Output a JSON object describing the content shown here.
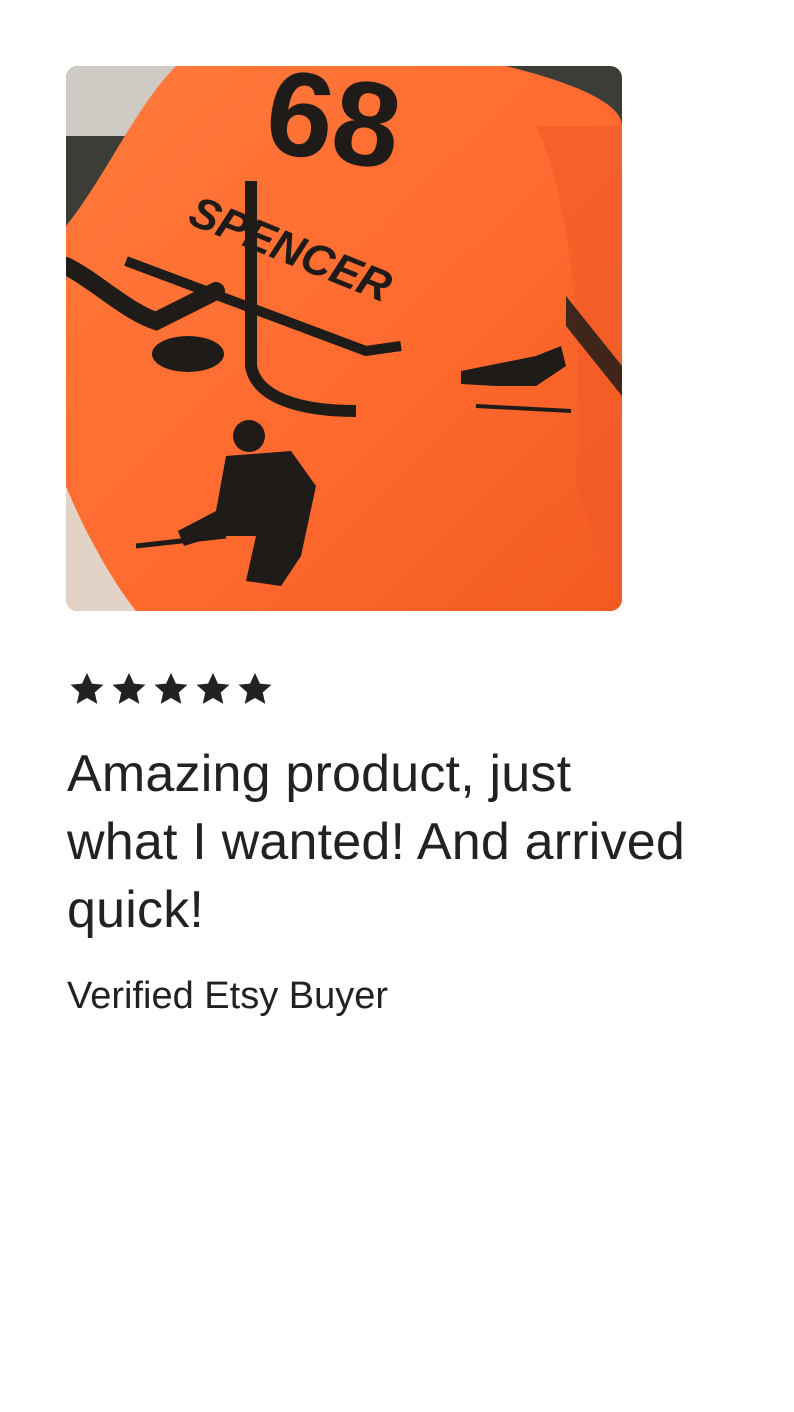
{
  "review": {
    "photo_alt": "Orange hockey blanket",
    "rating": 5,
    "rating_max": 5,
    "star_icon": "star-icon",
    "text": "Amazing product, just what I wanted! And arrived quick!",
    "reviewer": "Verified Etsy Buyer"
  },
  "photo_content": {
    "blanket_number": "68",
    "blanket_name": "SPENCER"
  },
  "colors": {
    "blanket_orange": "#ff6a2f",
    "print_black": "#1f1b19",
    "star": "#222222",
    "text": "#222222"
  }
}
